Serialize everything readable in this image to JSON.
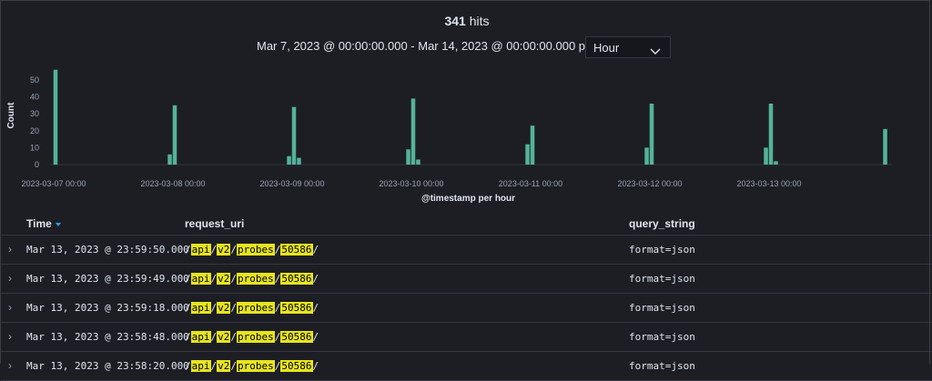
{
  "header": {
    "hits_count": "341",
    "hits_label": "hits",
    "date_range": "Mar 7, 2023 @ 00:00:00.000 - Mar 14, 2023 @ 00:00:00.000 per",
    "interval_value": "Hour"
  },
  "colors": {
    "bar": "#54b399",
    "highlight": "#e7e41f",
    "sort": "#1ba9f5"
  },
  "chart_data": {
    "type": "bar",
    "ylabel": "Count",
    "xlabel": "@timestamp per hour",
    "ylim": [
      0,
      58
    ],
    "yticks": [
      "0",
      "10",
      "20",
      "30",
      "40",
      "50"
    ],
    "x_tick_labels": [
      "2023-03-07 00:00",
      "2023-03-08 00:00",
      "2023-03-09 00:00",
      "2023-03-10 00:00",
      "2023-03-11 00:00",
      "2023-03-12 00:00",
      "2023-03-13 00:00"
    ],
    "x_range_hours": [
      0,
      168
    ],
    "bars": [
      {
        "hour": 0,
        "value": 56
      },
      {
        "hour": 23,
        "value": 6
      },
      {
        "hour": 24,
        "value": 35
      },
      {
        "hour": 47,
        "value": 5
      },
      {
        "hour": 48,
        "value": 34
      },
      {
        "hour": 49,
        "value": 4
      },
      {
        "hour": 71,
        "value": 9
      },
      {
        "hour": 72,
        "value": 39
      },
      {
        "hour": 73,
        "value": 3
      },
      {
        "hour": 95,
        "value": 12
      },
      {
        "hour": 96,
        "value": 23
      },
      {
        "hour": 119,
        "value": 10
      },
      {
        "hour": 120,
        "value": 36
      },
      {
        "hour": 143,
        "value": 10
      },
      {
        "hour": 144,
        "value": 36
      },
      {
        "hour": 145,
        "value": 2
      },
      {
        "hour": 167,
        "value": 21
      }
    ]
  },
  "table": {
    "columns": [
      "Time",
      "request_uri",
      "query_string"
    ],
    "rows": [
      {
        "time": "Mar 13, 2023 @ 23:59:50.000",
        "uri_parts": [
          "api",
          "v2",
          "probes",
          "50586"
        ],
        "query": "format=json"
      },
      {
        "time": "Mar 13, 2023 @ 23:59:49.000",
        "uri_parts": [
          "api",
          "v2",
          "probes",
          "50586"
        ],
        "query": "format=json"
      },
      {
        "time": "Mar 13, 2023 @ 23:59:18.000",
        "uri_parts": [
          "api",
          "v2",
          "probes",
          "50586"
        ],
        "query": "format=json"
      },
      {
        "time": "Mar 13, 2023 @ 23:58:48.000",
        "uri_parts": [
          "api",
          "v2",
          "probes",
          "50586"
        ],
        "query": "format=json"
      },
      {
        "time": "Mar 13, 2023 @ 23:58:20.000",
        "uri_parts": [
          "api",
          "v2",
          "probes",
          "50586"
        ],
        "query": "format=json"
      }
    ]
  }
}
